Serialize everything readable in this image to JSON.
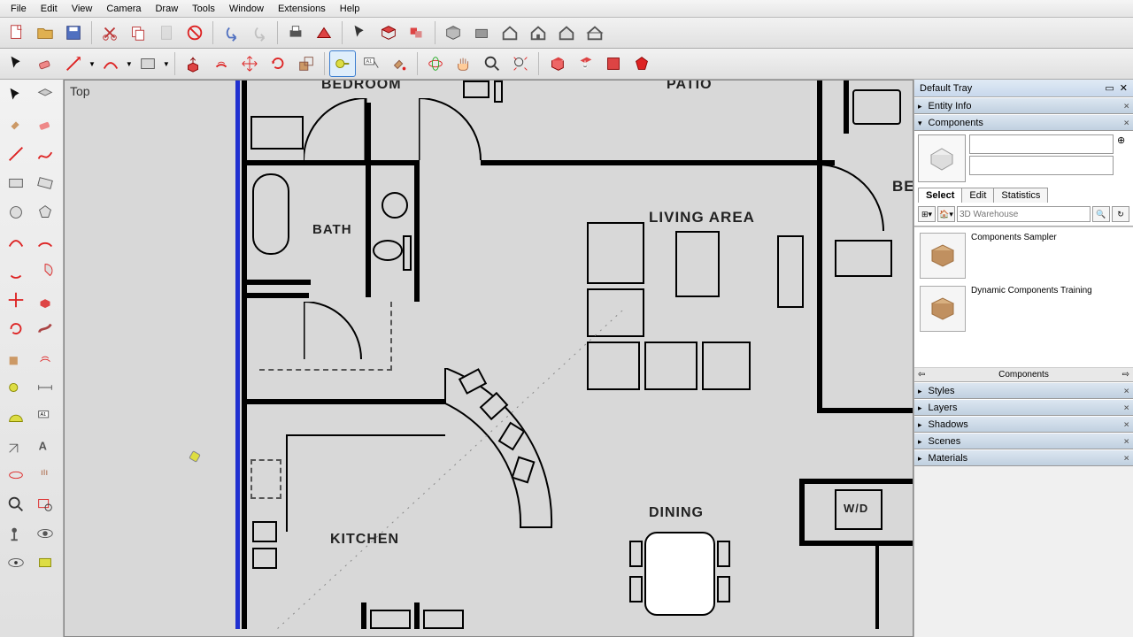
{
  "menus": [
    "File",
    "Edit",
    "View",
    "Camera",
    "Draw",
    "Tools",
    "Window",
    "Extensions",
    "Help"
  ],
  "canvas_view": "Top",
  "tray_title": "Default Tray",
  "panels": {
    "entity_info": "Entity Info",
    "components": "Components",
    "styles": "Styles",
    "layers": "Layers",
    "shadows": "Shadows",
    "scenes": "Scenes",
    "materials": "Materials"
  },
  "component_tabs": [
    "Select",
    "Edit",
    "Statistics"
  ],
  "search_placeholder": "3D Warehouse",
  "nav_label": "Components",
  "components_list": [
    {
      "name": "Components Sampler"
    },
    {
      "name": "Dynamic Components Training"
    }
  ],
  "rooms": {
    "bedroom": "BEDROOM",
    "patio": "PATIO",
    "bath": "BATH",
    "living": "LIVING AREA",
    "kitchen": "KITCHEN",
    "dining": "DINING",
    "be": "BE",
    "wd": "W/D"
  }
}
